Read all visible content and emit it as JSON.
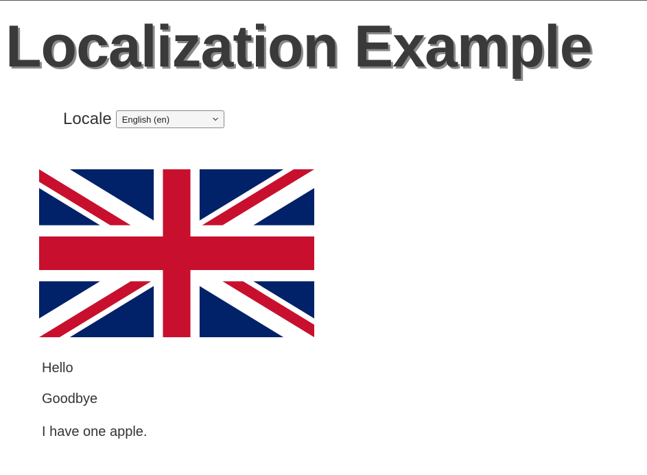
{
  "header": {
    "title": "Localization Example"
  },
  "locale": {
    "label": "Locale",
    "selected": "English (en)"
  },
  "flag": {
    "name": "union-jack",
    "colors": {
      "blue": "#012169",
      "white": "#ffffff",
      "red": "#C8102E"
    }
  },
  "messages": {
    "hello": "Hello",
    "goodbye": "Goodbye",
    "apples": "I have one apple."
  }
}
